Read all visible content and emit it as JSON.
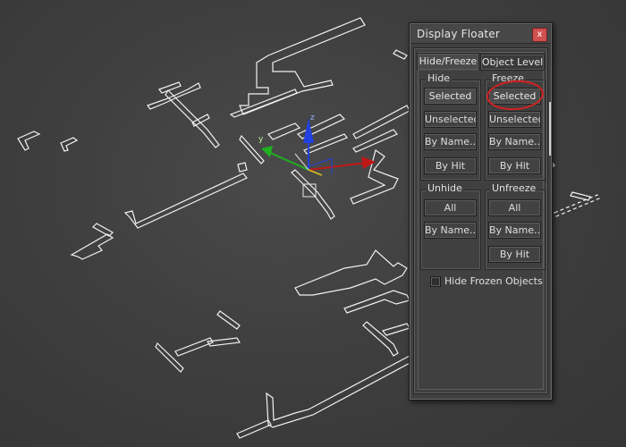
{
  "window": {
    "title": "Display Floater",
    "close_glyph": "x"
  },
  "tabs": [
    {
      "label": "Hide/Freeze",
      "active": true
    },
    {
      "label": "Object Level",
      "active": false
    }
  ],
  "groups": {
    "hide": {
      "label": "Hide",
      "buttons": [
        "Selected",
        "Unselected",
        "By Name...",
        "By Hit"
      ]
    },
    "freeze": {
      "label": "Freeze",
      "buttons": [
        "Selected",
        "Unselected",
        "By Name...",
        "By Hit"
      ]
    },
    "unhide": {
      "label": "Unhide",
      "buttons": [
        "All",
        "By Name..."
      ]
    },
    "unfreeze": {
      "label": "Unfreeze",
      "buttons": [
        "All",
        "By Name...",
        "By Hit"
      ]
    }
  },
  "options": {
    "hide_frozen_objects": {
      "label": "Hide Frozen Objects",
      "checked": false
    }
  },
  "gizmo": {
    "axis_y_label": "y",
    "axis_z_label": "z",
    "axis_x_color": "#d42020",
    "axis_y_color": "#20b020",
    "axis_z_color": "#2040e0"
  },
  "annotation": {
    "highlight_color": "#d42020",
    "highlight_target": "freeze-selected-button"
  },
  "colors": {
    "viewport_bg": "#3f3f3f",
    "panel_bg": "#404040",
    "wireframe": "#ffffff"
  }
}
